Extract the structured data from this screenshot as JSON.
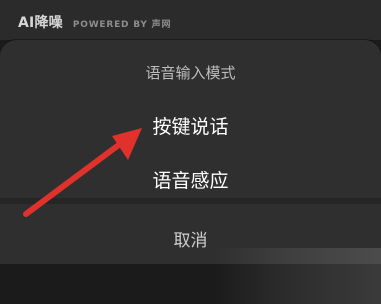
{
  "header": {
    "brand_title": "AI降噪",
    "brand_sub": "POWERED BY 声网"
  },
  "sheet": {
    "title": "语音输入模式",
    "options": [
      {
        "label": "按键说话"
      },
      {
        "label": "语音感应"
      }
    ],
    "cancel_label": "取消"
  },
  "annotation": {
    "arrow_color": "#e0312c"
  },
  "colors": {
    "sheet_bg": "#2f2f2f",
    "top_bg": "#2b2b2b",
    "text_primary": "#ffffff",
    "text_secondary": "#bdbdbd",
    "text_cancel": "#cfcfcf"
  }
}
